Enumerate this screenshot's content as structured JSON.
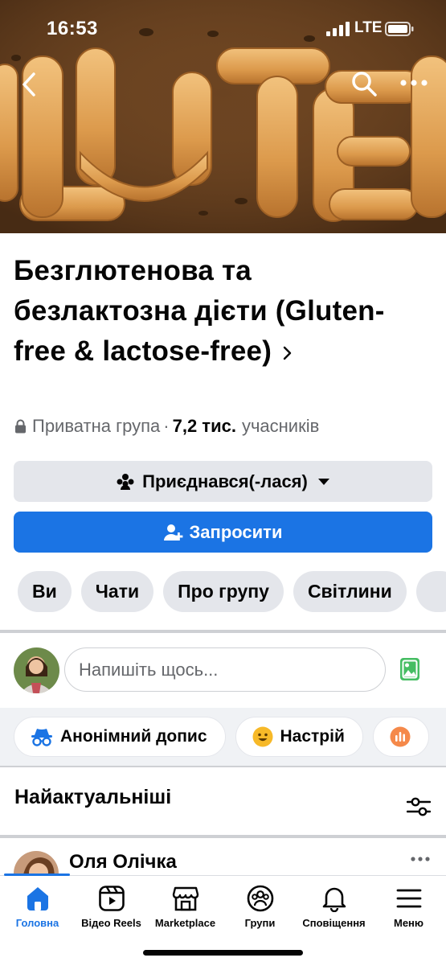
{
  "status_bar": {
    "time": "16:53",
    "network": "LTE"
  },
  "cover": {
    "back_icon": "chevron-left-icon",
    "search_icon": "search-icon",
    "more_icon": "more-horizontal-icon"
  },
  "group": {
    "title": "Безглютенова та безлактозна дієти (Gluten-free & lactose-free)",
    "privacy": "Приватна група",
    "dot": "·",
    "members_count": "7,2 тис.",
    "members_label": "учасників"
  },
  "actions": {
    "joined_label": "Приєднався(-лася)",
    "invite_label": "Запросити"
  },
  "tabs": [
    "Ви",
    "Чати",
    "Про групу",
    "Світлини"
  ],
  "composer": {
    "placeholder": "Напишіть щось..."
  },
  "chips": [
    {
      "label": "Анонімний допис",
      "icon": "incognito-icon"
    },
    {
      "label": "Настрій",
      "icon": "smile-icon"
    }
  ],
  "feed": {
    "section_title": "Найактуальніші"
  },
  "post": {
    "author": "Оля Олічка"
  },
  "bottom_nav": [
    {
      "label": "Головна",
      "icon": "home-icon",
      "active": true
    },
    {
      "label": "Відео Reels",
      "icon": "video-icon",
      "active": false
    },
    {
      "label": "Marketplace",
      "icon": "marketplace-icon",
      "active": false
    },
    {
      "label": "Групи",
      "icon": "groups-icon",
      "active": false
    },
    {
      "label": "Сповіщення",
      "icon": "bell-icon",
      "active": false
    },
    {
      "label": "Меню",
      "icon": "menu-icon",
      "active": false
    }
  ],
  "colors": {
    "accent": "#1b74e4",
    "secondary_button": "#e4e6eb",
    "muted_text": "#65676b",
    "feed_background": "#f0f2f5"
  }
}
